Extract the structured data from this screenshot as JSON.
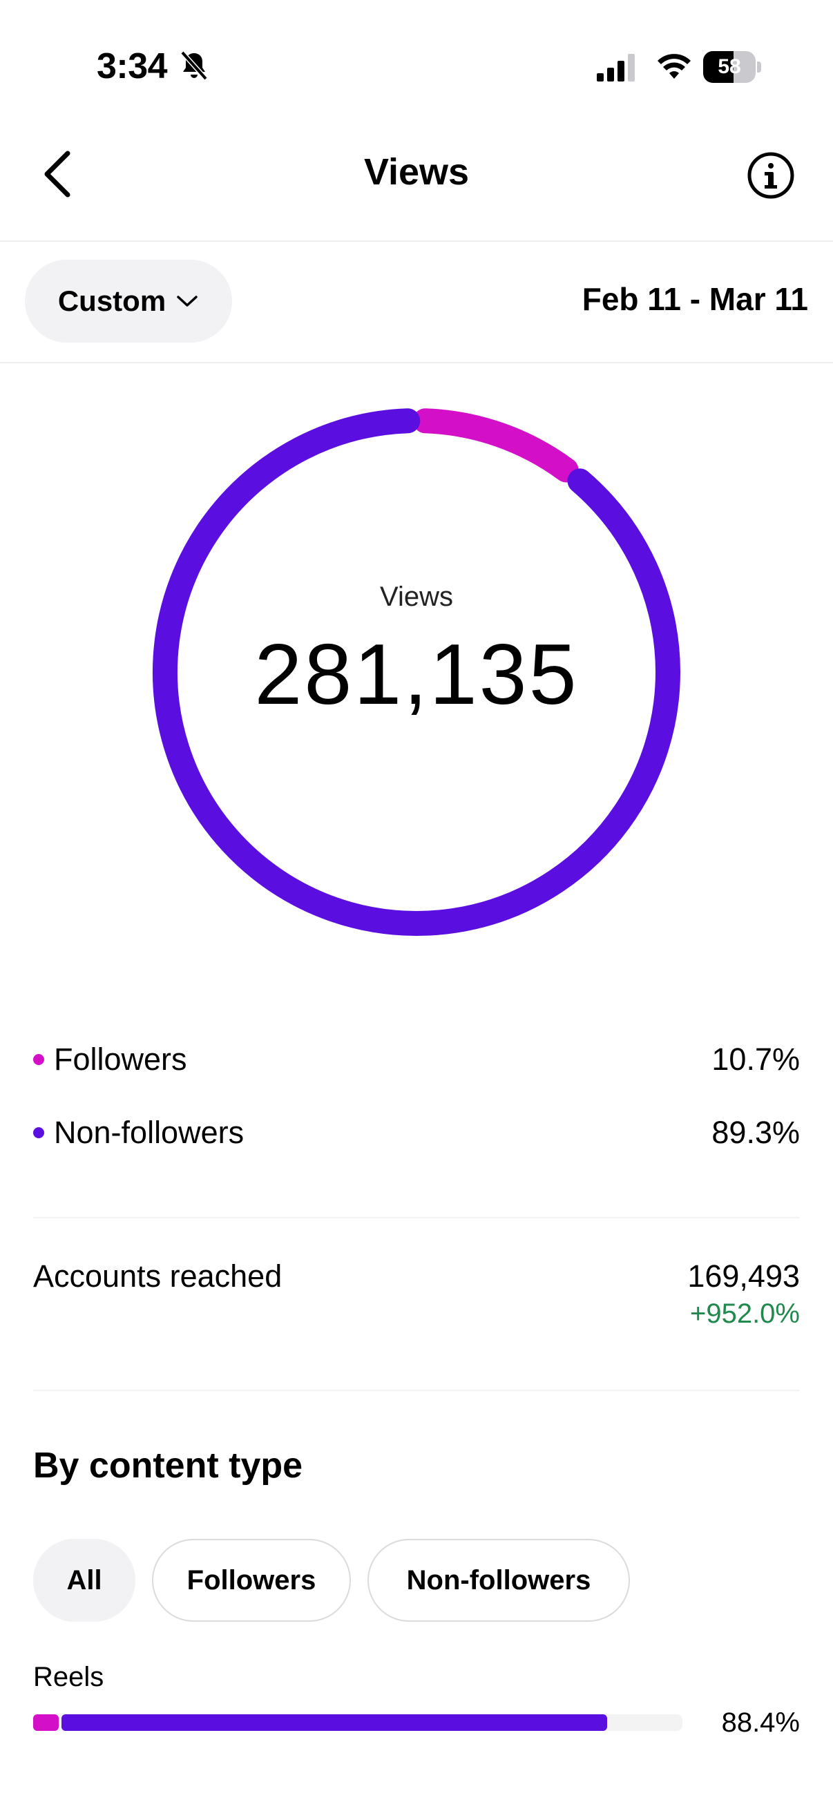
{
  "status_bar": {
    "time": "3:34",
    "battery": 58,
    "icons": [
      "bell-slash-icon",
      "signal-icon",
      "wifi-icon",
      "battery-icon"
    ]
  },
  "header": {
    "title": "Views",
    "back_icon": "chevron-left-icon",
    "info_icon": "info-icon"
  },
  "filter": {
    "range_label": "Custom",
    "date_range": "Feb 11 - Mar 11"
  },
  "summary": {
    "label": "Views",
    "value": "281,135"
  },
  "chart_data": {
    "type": "pie",
    "categories": [
      "Followers",
      "Non-followers"
    ],
    "values": [
      10.7,
      89.3
    ],
    "colors": [
      "#d40fc8",
      "#5a0fe0"
    ]
  },
  "legend": [
    {
      "label": "Followers",
      "value": "10.7%",
      "color": "#d40fc8"
    },
    {
      "label": "Non-followers",
      "value": "89.3%",
      "color": "#5a0fe0"
    }
  ],
  "accounts_reached": {
    "label": "Accounts reached",
    "value": "169,493",
    "change": "+952.0%",
    "change_color": "#1f8a4c"
  },
  "content_type": {
    "title": "By content type",
    "tabs": [
      {
        "label": "All",
        "active": true
      },
      {
        "label": "Followers",
        "active": false
      },
      {
        "label": "Non-followers",
        "active": false
      }
    ],
    "items": [
      {
        "label": "Reels",
        "value": "88.4%",
        "total": 88.4,
        "followers_part": 4.4,
        "nonfollowers_part": 84.0
      }
    ]
  },
  "colors": {
    "followers": "#d40fc8",
    "non_followers": "#5a0fe0",
    "positive": "#1f8a4c"
  }
}
